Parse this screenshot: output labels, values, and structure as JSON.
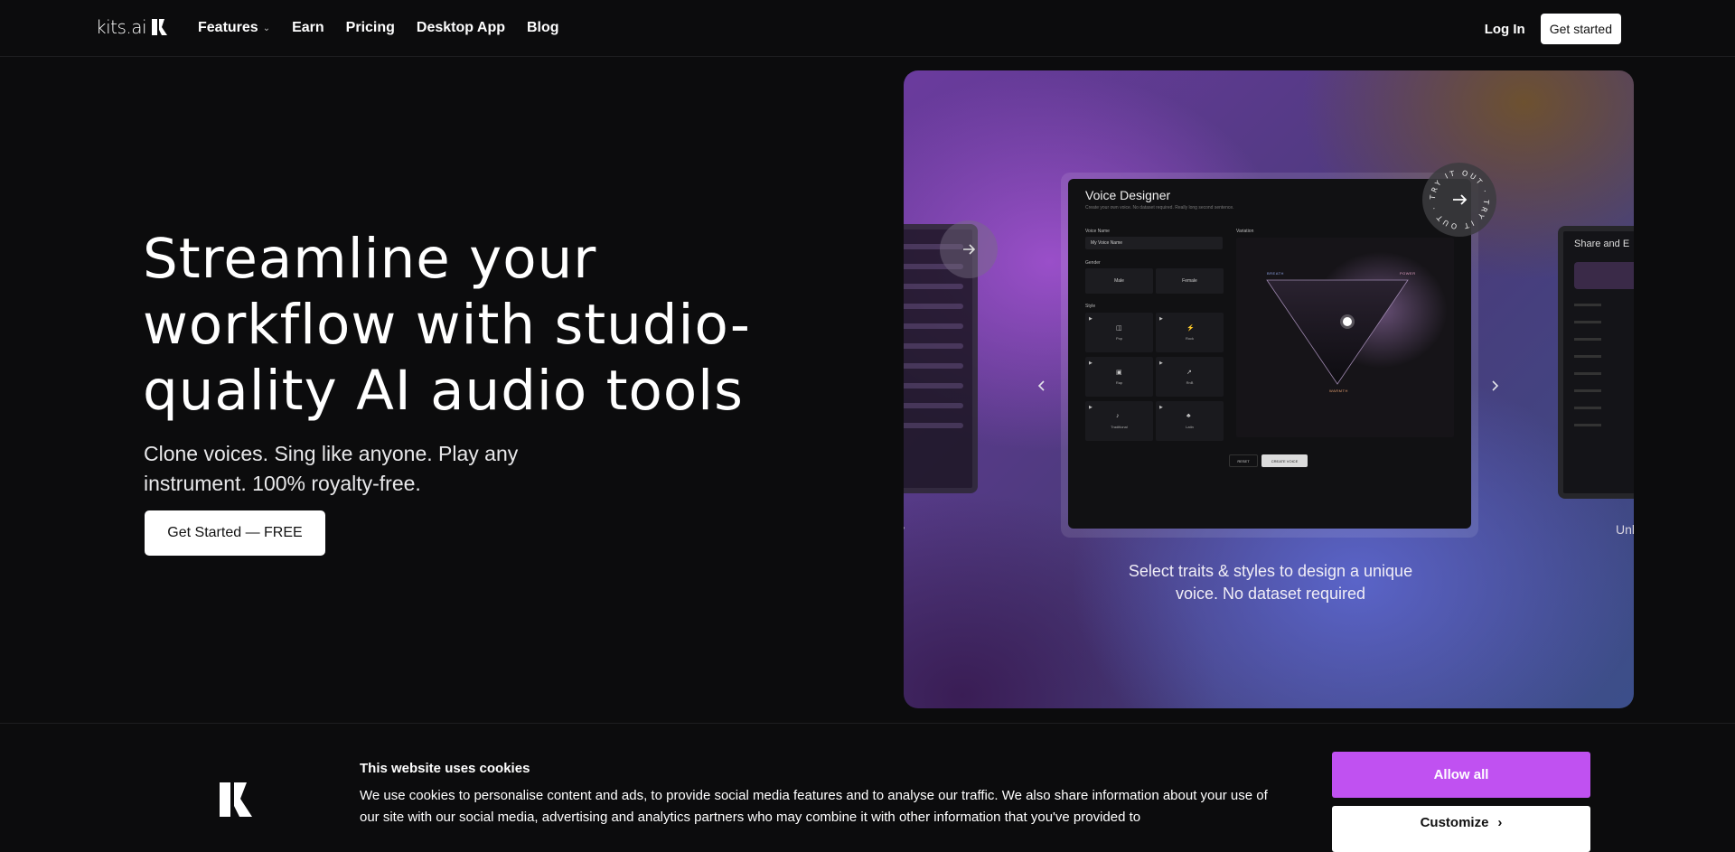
{
  "nav": {
    "logo_text": "kits.ai",
    "links": [
      "Features",
      "Earn",
      "Pricing",
      "Desktop App",
      "Blog"
    ],
    "features_chevron_icon": "chevron-down-icon",
    "login_label": "Log In",
    "get_started_label": "Get started"
  },
  "hero": {
    "headline": "Streamline your workflow with studio-quality AI audio tools",
    "subtext": "Clone voices. Sing like anyone. Play any instrument.  100% royalty-free.",
    "cta_label": "Get Started — FREE"
  },
  "showcase": {
    "prev_icon": "chevron-left-icon",
    "next_icon": "chevron-right-icon",
    "badge_text": "TRY IT OUT · TRY IT OUT ·",
    "caption": "Select traits & styles to design a unique voice. No dataset required",
    "left_card_label": "y",
    "right_card_label": "Unl",
    "right_card_title": "Share and E",
    "voice_designer": {
      "title": "Voice Designer",
      "subtitle": "Create your own voice. No dataset required. Really long second sentence.",
      "voice_name_label": "Voice Name",
      "voice_name_value": "My Voice Name",
      "gender_label": "Gender",
      "genders": [
        "Male",
        "Female"
      ],
      "style_label": "Style",
      "styles": [
        "Pop",
        "Rock",
        "Rap",
        "RnB",
        "Traditional",
        "Latin"
      ],
      "variation_label": "Variation",
      "triangle_labels": {
        "top_left": "BREATH",
        "top_right": "POWER",
        "bottom": "WARMTH"
      },
      "reset_label": "RESET",
      "create_label": "CREATE VOICE"
    }
  },
  "cookies": {
    "title": "This website uses cookies",
    "text": "We use cookies to personalise content and ads, to provide social media features and to analyse our traffic. We also share information about your use of our site with our social media, advertising and analytics partners who may combine it with other information that you've provided to",
    "allow_label": "Allow all",
    "customize_label": "Customize"
  },
  "colors": {
    "accent": "#c051f1",
    "background": "#0c0c0d"
  }
}
